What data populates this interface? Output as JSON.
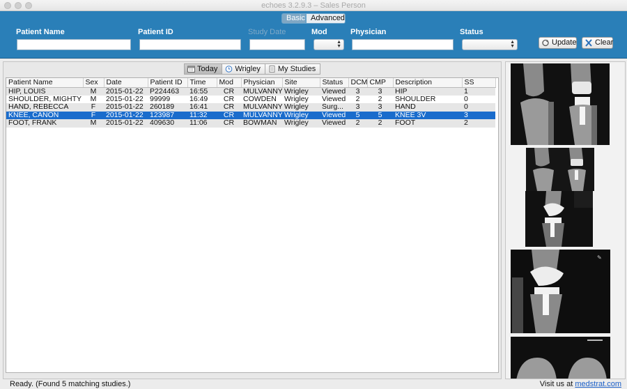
{
  "window": {
    "title": "echoes 3.2.9.3  –  Sales Person"
  },
  "mode": {
    "basic_label": "Basic",
    "advanced_label": "Advanced",
    "selected": "Basic"
  },
  "search": {
    "patient_name_label": "Patient Name",
    "patient_id_label": "Patient ID",
    "study_date_label": "Study Date",
    "mod_label": "Mod",
    "physician_label": "Physician",
    "status_label": "Status",
    "patient_name_value": "",
    "patient_id_value": "",
    "study_date_value": "",
    "physician_value": "",
    "update_label": "Update",
    "clear_label": "Clear"
  },
  "tabs": [
    {
      "label": "Today",
      "icon": "calendar-icon",
      "active": true
    },
    {
      "label": "Wrigley",
      "icon": "clock-icon",
      "active": false
    },
    {
      "label": "My Studies",
      "icon": "document-icon",
      "active": false
    }
  ],
  "table": {
    "columns": [
      "Patient Name",
      "Sex",
      "Date",
      "Patient ID",
      "Time",
      "Mod",
      "Physician",
      "Site",
      "Status",
      "DCM",
      "CMP",
      "Description",
      "SS"
    ],
    "rows": [
      [
        "HIP, LOUIS",
        "M",
        "2015-01-22",
        "P224463",
        "16:55",
        "CR",
        "MULVANNY",
        "Wrigley",
        "Viewed",
        "3",
        "3",
        "HIP",
        "1"
      ],
      [
        "SHOULDER, MIGHTY",
        "M",
        "2015-01-22",
        "99999",
        "16:49",
        "CR",
        "COWDEN",
        "Wrigley",
        "Viewed",
        "2",
        "2",
        "SHOULDER",
        "0"
      ],
      [
        "HAND, REBECCA",
        "F",
        "2015-01-22",
        "260189",
        "16:41",
        "CR",
        "MULVANNY",
        "Wrigley",
        "Surg...",
        "3",
        "3",
        "HAND",
        "0"
      ],
      [
        "KNEE, CANON",
        "F",
        "2015-01-22",
        "123987",
        "11:32",
        "CR",
        "MULVANNY",
        "Wrigley",
        "Viewed",
        "5",
        "5",
        "KNEE 3V",
        "3"
      ],
      [
        "FOOT, FRANK",
        "M",
        "2015-01-22",
        "409630",
        "11:06",
        "CR",
        "BOWMAN",
        "Wrigley",
        "Viewed",
        "2",
        "2",
        "FOOT",
        "2"
      ]
    ],
    "selected_row": 3
  },
  "status": {
    "text": "Ready.  (Found 5 matching studies.)",
    "visit_prefix": "Visit us at",
    "visit_link": "medstrat.com"
  },
  "colors": {
    "panel": "#2a7fb8",
    "selection": "#1a6ccc",
    "link": "#1a5fc8"
  }
}
